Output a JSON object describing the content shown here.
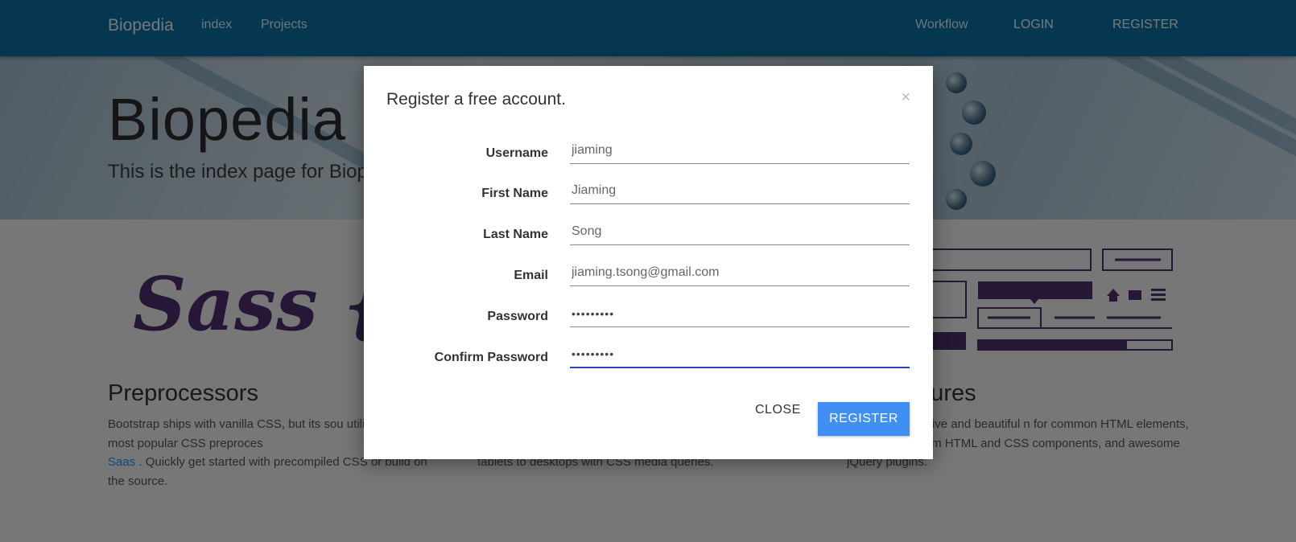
{
  "navbar": {
    "brand": "Biopedia",
    "links": [
      "index",
      "Projects"
    ],
    "right": {
      "workflow": "Workflow",
      "login": "LOGIN",
      "register": "REGISTER"
    },
    "color": "#0b6ea1"
  },
  "jumbotron": {
    "title": "Biopedia",
    "subtitle": "This is the index page for Biop"
  },
  "sections": [
    {
      "heading": "Preprocessors",
      "text_before": "Bootstrap ships with vanilla CSS, but its sou utilizes the two most popular CSS preproces",
      "link": "Saas",
      "text_after": " . Quickly get started with precompiled CSS or build on the source."
    },
    {
      "text": "tablets to desktops with CSS media queries."
    },
    {
      "heading": "atures",
      "text": ", you get extensive and beautiful n for common HTML elements, dozens of custom HTML and CSS components, and awesome jQuery plugins."
    }
  ],
  "logo_text": "Sass {les",
  "modal": {
    "title": "Register a free account.",
    "close_icon": "×",
    "fields": [
      {
        "label": "Username",
        "value": "jiaming"
      },
      {
        "label": "First Name",
        "value": "Jiaming"
      },
      {
        "label": "Last Name",
        "value": "Song"
      },
      {
        "label": "Email",
        "value": "jiaming.tsong@gmail.com"
      },
      {
        "label": "Password",
        "value": "•••••••••"
      },
      {
        "label": "Confirm Password",
        "value": "•••••••••"
      }
    ],
    "close_button": "CLOSE",
    "register_button": "REGISTER",
    "accent": "#3f8ff5"
  }
}
